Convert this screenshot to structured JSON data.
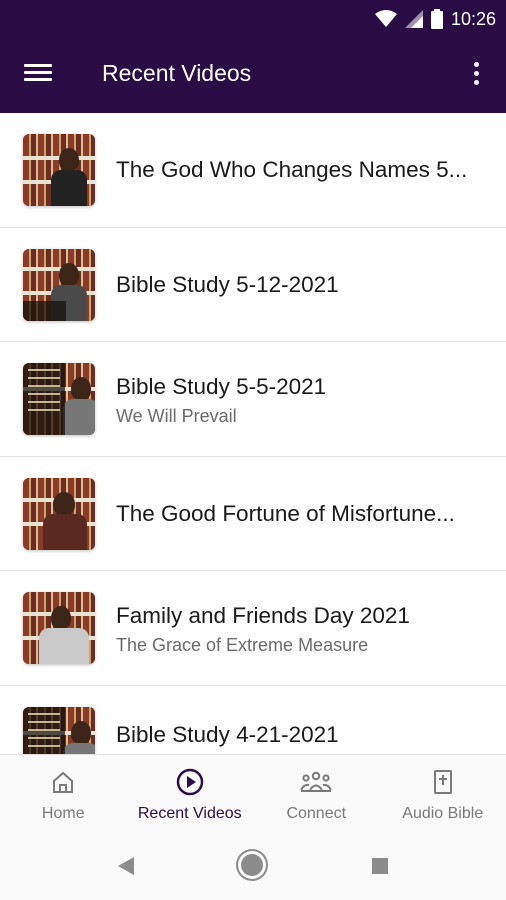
{
  "status_bar": {
    "time": "10:26"
  },
  "app_bar": {
    "title": "Recent Videos",
    "menu_icon": "hamburger-menu-icon",
    "overflow_icon": "more-vert-icon"
  },
  "videos": [
    {
      "title": "The God Who Changes Names 5...",
      "subtitle": ""
    },
    {
      "title": "Bible Study 5-12-2021",
      "subtitle": ""
    },
    {
      "title": "Bible Study 5-5-2021",
      "subtitle": "We Will Prevail"
    },
    {
      "title": "The Good Fortune of Misfortune...",
      "subtitle": ""
    },
    {
      "title": "Family and Friends Day 2021",
      "subtitle": "The Grace of Extreme Measure"
    },
    {
      "title": "Bible Study 4-21-2021",
      "subtitle": ""
    }
  ],
  "bottom_nav": {
    "home": "Home",
    "recent_videos": "Recent Videos",
    "connect": "Connect",
    "audio_bible": "Audio Bible",
    "active": "recent_videos"
  },
  "colors": {
    "primary": "#2a0d45",
    "inactive": "#7a7a7a"
  }
}
